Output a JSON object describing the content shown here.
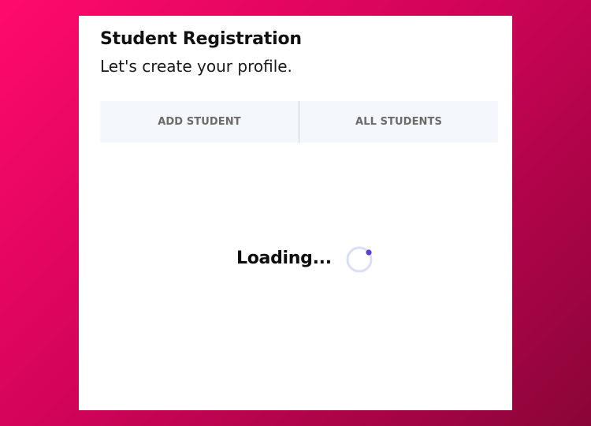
{
  "header": {
    "title": "Student Registration",
    "subtitle": "Let's create your profile."
  },
  "tabs": [
    {
      "label": "ADD STUDENT"
    },
    {
      "label": "ALL STUDENTS"
    }
  ],
  "status": {
    "loading_text": "Loading..."
  },
  "colors": {
    "background_start": "#ff0a6c",
    "background_end": "#8a0537",
    "tab_background": "#f4f7fc",
    "tab_text": "#6b6b6b",
    "spinner_track": "#d9def5",
    "spinner_dot": "#5b3fd6"
  }
}
